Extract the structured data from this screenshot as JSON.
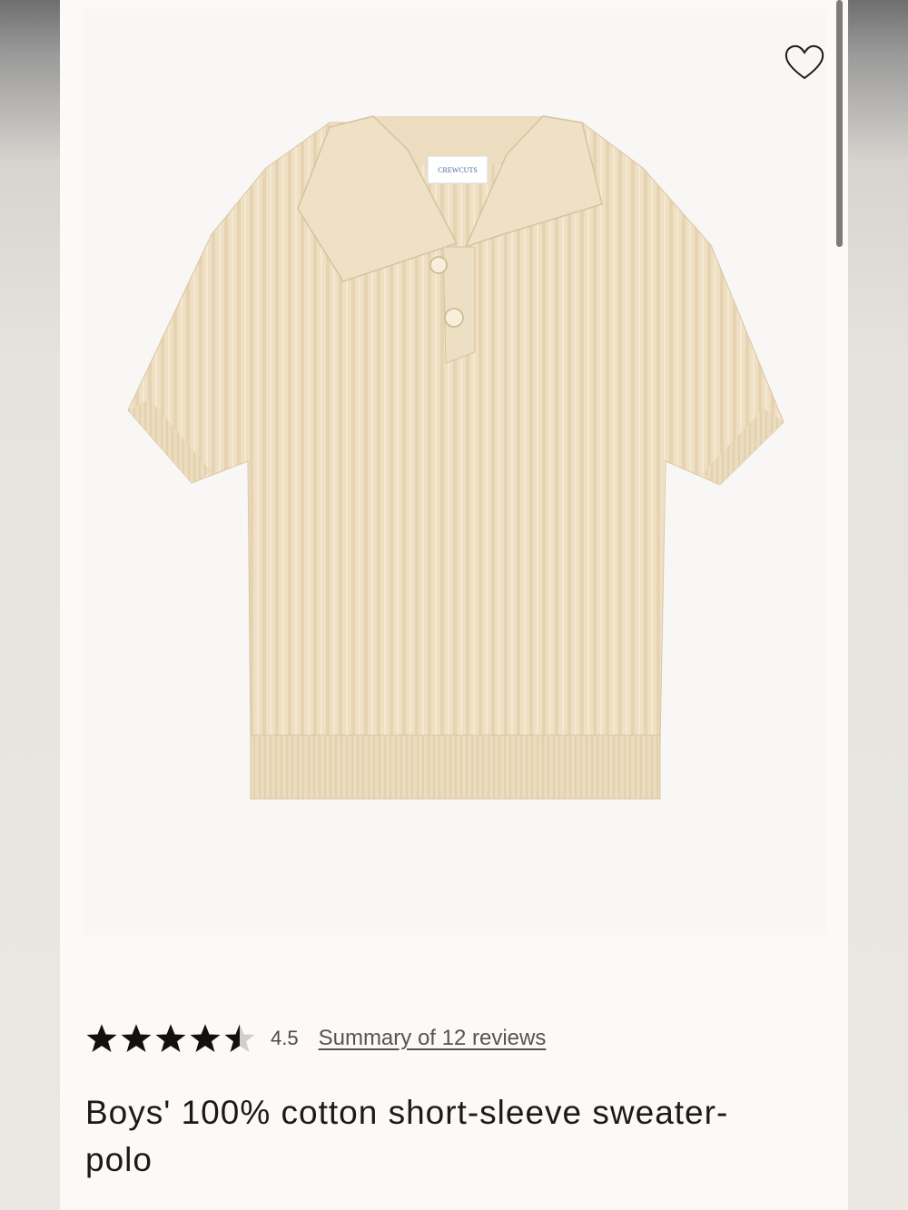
{
  "product": {
    "image_alt": "Boys' 100% cotton short-sleeve sweater-polo",
    "brand_tag": "CREWCUTS",
    "color": "#efe0c4",
    "wishlist_icon": "heart-outline-icon"
  },
  "rating": {
    "value": "4.5",
    "stars_filled": 4.5,
    "stars_max": 5,
    "reviews_link": "Summary of 12 reviews"
  },
  "title": "Boys' 100% cotton short-sleeve sweater-polo",
  "colors": {
    "page_bg": "#fcf9f7",
    "image_bg": "#f9f7f5",
    "text": "#1a1a1a",
    "star": "#111111"
  }
}
